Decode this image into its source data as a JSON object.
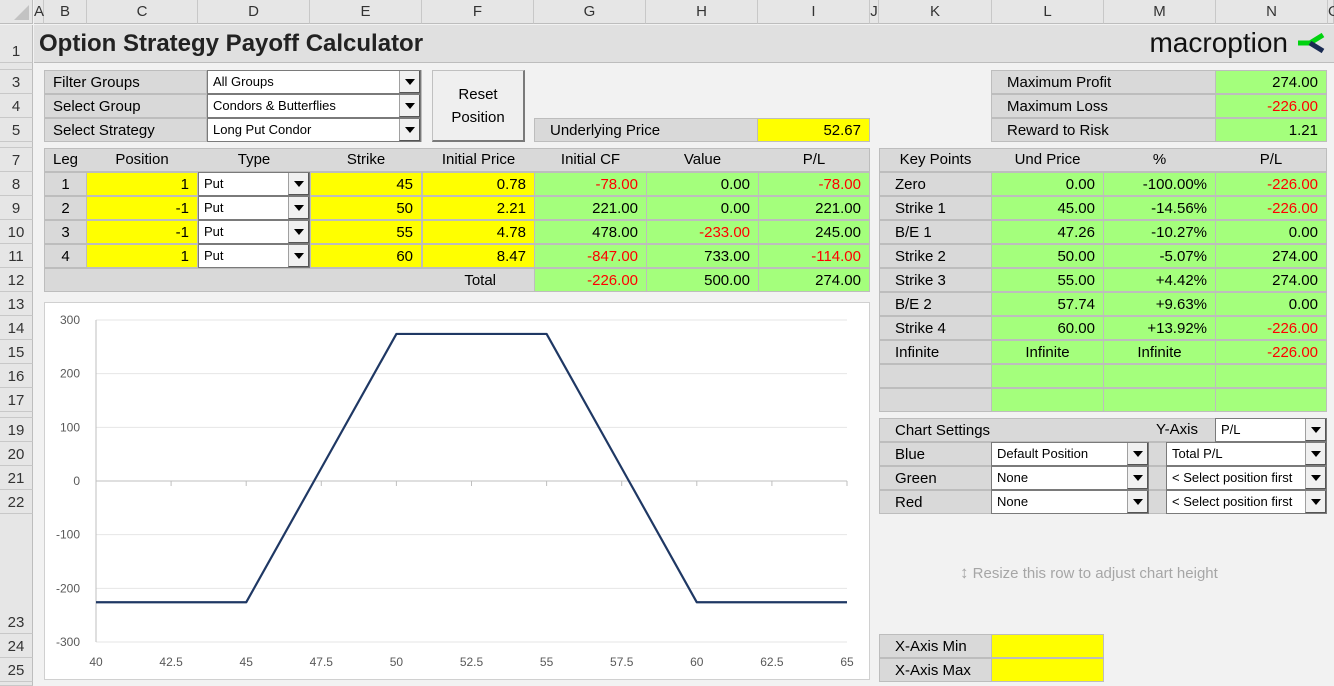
{
  "spreadsheet": {
    "columns": [
      "A",
      "B",
      "C",
      "D",
      "E",
      "F",
      "G",
      "H",
      "I",
      "J",
      "K",
      "L",
      "M",
      "N",
      "O"
    ],
    "rows": [
      "1",
      "3",
      "4",
      "5",
      "7",
      "8",
      "9",
      "10",
      "11",
      "12",
      "13",
      "14",
      "15",
      "16",
      "17",
      "19",
      "20",
      "21",
      "22",
      "23",
      "24",
      "25"
    ]
  },
  "header": {
    "title": "Option Strategy Payoff Calculator",
    "logo_text": "macroption",
    "logo_colors": {
      "green": "#00d30f",
      "navy": "#1a2b52"
    }
  },
  "filters": {
    "filter_groups_label": "Filter Groups",
    "filter_groups_value": "All Groups",
    "select_group_label": "Select Group",
    "select_group_value": "Condors & Butterflies",
    "select_strategy_label": "Select Strategy",
    "select_strategy_value": "Long Put Condor",
    "reset_button": "Reset Position",
    "reset_line1": "Reset",
    "reset_line2": "Position"
  },
  "underlying": {
    "label": "Underlying Price",
    "value": "52.67"
  },
  "summary": {
    "max_profit_label": "Maximum Profit",
    "max_profit": "274.00",
    "max_loss_label": "Maximum Loss",
    "max_loss": "-226.00",
    "reward_risk_label": "Reward to Risk",
    "reward_risk": "1.21"
  },
  "legs": {
    "headers": [
      "Leg",
      "Position",
      "Type",
      "Strike",
      "Initial Price",
      "Initial CF",
      "Value",
      "P/L"
    ],
    "rows": [
      {
        "leg": "1",
        "position": "1",
        "type": "Put",
        "strike": "45",
        "initial_price": "0.78",
        "initial_cf": "-78.00",
        "value": "0.00",
        "pl": "-78.00"
      },
      {
        "leg": "2",
        "position": "-1",
        "type": "Put",
        "strike": "50",
        "initial_price": "2.21",
        "initial_cf": "221.00",
        "value": "0.00",
        "pl": "221.00"
      },
      {
        "leg": "3",
        "position": "-1",
        "type": "Put",
        "strike": "55",
        "initial_price": "4.78",
        "initial_cf": "478.00",
        "value": "-233.00",
        "pl": "245.00"
      },
      {
        "leg": "4",
        "position": "1",
        "type": "Put",
        "strike": "60",
        "initial_price": "8.47",
        "initial_cf": "-847.00",
        "value": "733.00",
        "pl": "-114.00"
      }
    ],
    "total": {
      "label": "Total",
      "initial_cf": "-226.00",
      "value": "500.00",
      "pl": "274.00"
    }
  },
  "key_points": {
    "headers": [
      "Key Points",
      "Und Price",
      "%",
      "P/L"
    ],
    "rows": [
      {
        "name": "Zero",
        "und_price": "0.00",
        "pct": "-100.00%",
        "pl": "-226.00"
      },
      {
        "name": "Strike 1",
        "und_price": "45.00",
        "pct": "-14.56%",
        "pl": "-226.00"
      },
      {
        "name": "B/E 1",
        "und_price": "47.26",
        "pct": "-10.27%",
        "pl": "0.00"
      },
      {
        "name": "Strike 2",
        "und_price": "50.00",
        "pct": "-5.07%",
        "pl": "274.00"
      },
      {
        "name": "Strike 3",
        "und_price": "55.00",
        "pct": "+4.42%",
        "pl": "274.00"
      },
      {
        "name": "B/E 2",
        "und_price": "57.74",
        "pct": "+9.63%",
        "pl": "0.00"
      },
      {
        "name": "Strike 4",
        "und_price": "60.00",
        "pct": "+13.92%",
        "pl": "-226.00"
      },
      {
        "name": "Infinite",
        "und_price": "Infinite",
        "pct": "Infinite",
        "pl": "-226.00"
      },
      {
        "name": "",
        "und_price": "",
        "pct": "",
        "pl": ""
      },
      {
        "name": "",
        "und_price": "",
        "pct": "",
        "pl": ""
      }
    ]
  },
  "chart_settings": {
    "title": "Chart Settings",
    "y_axis_label": "Y-Axis",
    "y_axis_value": "P/L",
    "rows": [
      {
        "label": "Blue",
        "position": "Default Position",
        "series": "Total P/L"
      },
      {
        "label": "Green",
        "position": "None",
        "series": "< Select position first"
      },
      {
        "label": "Red",
        "position": "None",
        "series": "< Select position first"
      }
    ]
  },
  "resize_hint": "Resize this row to adjust chart height",
  "x_axis": {
    "min_label": "X-Axis Min",
    "min_value": "",
    "max_label": "X-Axis Max",
    "max_value": ""
  },
  "chart_data": {
    "type": "line",
    "title": "",
    "xlabel": "",
    "ylabel": "",
    "xlim": [
      40,
      65
    ],
    "ylim": [
      -300,
      300
    ],
    "x_ticks": [
      "40",
      "42.5",
      "45",
      "47.5",
      "50",
      "52.5",
      "55",
      "57.5",
      "60",
      "62.5",
      "65"
    ],
    "y_ticks": [
      "300",
      "200",
      "100",
      "0",
      "-100",
      "-200",
      "-300"
    ],
    "grid": true,
    "legend": "none",
    "series": [
      {
        "name": "Total P/L",
        "color": "#1f3864",
        "x": [
          40,
          45,
          47.26,
          50,
          55,
          57.74,
          60,
          65
        ],
        "y": [
          -226,
          -226,
          0,
          274,
          274,
          0,
          -226,
          -226
        ]
      }
    ]
  }
}
